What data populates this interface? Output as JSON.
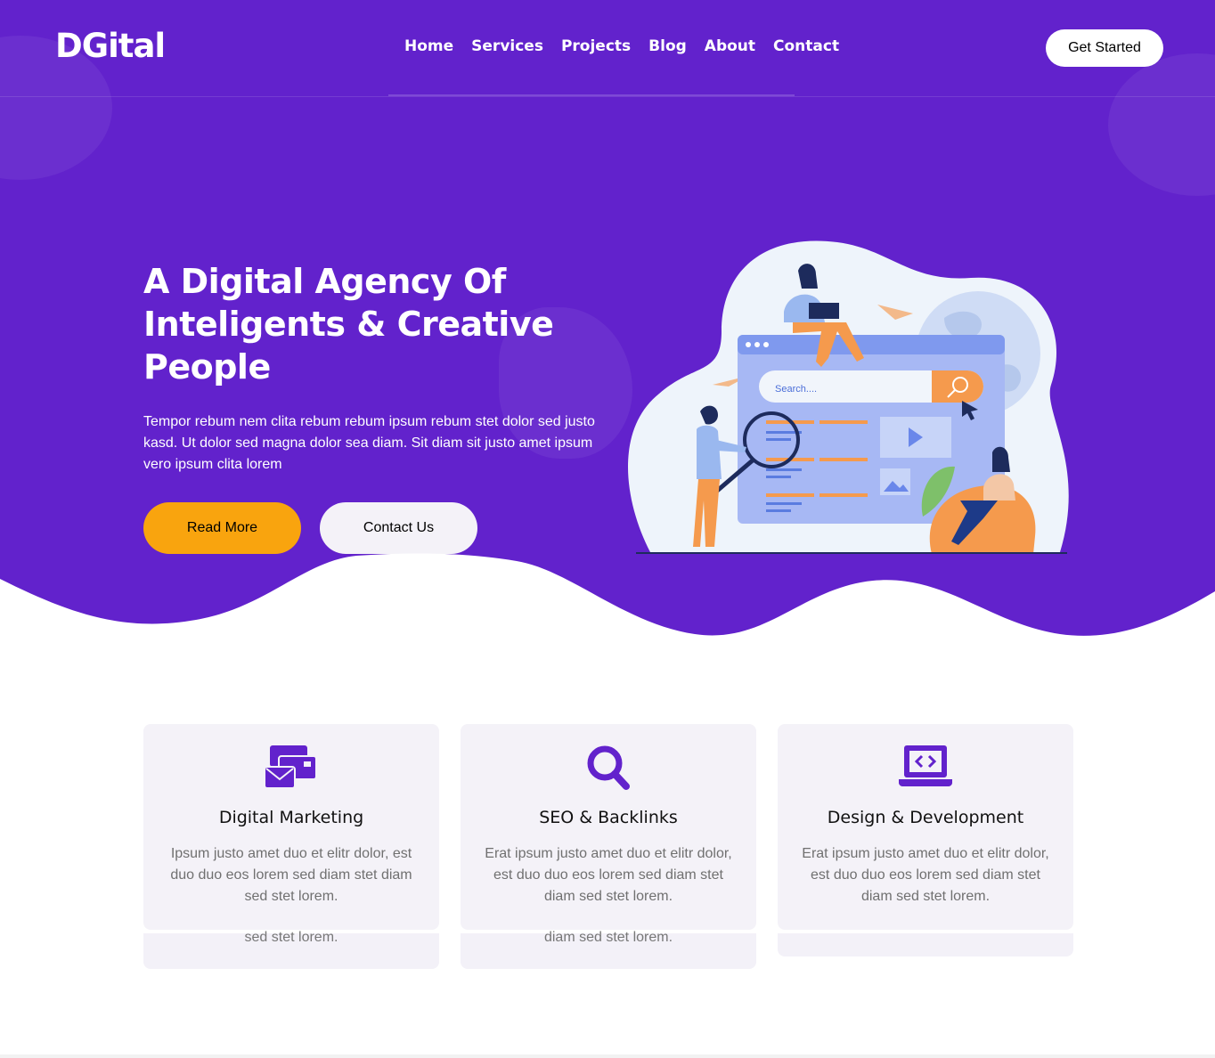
{
  "brand": {
    "logo": "DGital",
    "primary_color": "#6222cc",
    "accent_color": "#f9a40e"
  },
  "nav": {
    "links": [
      "Home",
      "Services",
      "Projects",
      "Blog",
      "About",
      "Contact"
    ],
    "cta": "Get Started"
  },
  "hero": {
    "title": "A Digital Agency Of Inteligents & Creative People",
    "text": "Tempor rebum nem clita rebum rebum ipsum rebum stet dolor sed justo kasd. Ut dolor sed magna dolor sea diam. Sit diam sit justo amet ipsum vero ipsum clita lorem",
    "read_more": "Read More",
    "contact_us": "Contact Us",
    "illustration": {
      "search_placeholder": "Search...."
    }
  },
  "services": [
    {
      "icon": "email-marketing-icon",
      "title": "Digital Marketing",
      "text": "Ipsum justo amet duo et elitr dolor, est duo duo eos lorem sed diam stet diam sed stet lorem.",
      "overflow_text": "sed stet lorem."
    },
    {
      "icon": "search-icon",
      "title": "SEO & Backlinks",
      "text": "Erat ipsum justo amet duo et elitr dolor, est duo duo eos lorem sed diam stet diam sed stet lorem.",
      "overflow_text": "diam sed stet lorem."
    },
    {
      "icon": "laptop-code-icon",
      "title": "Design & Development",
      "text": "Erat ipsum justo amet duo et elitr dolor, est duo duo eos lorem sed diam stet diam sed stet lorem.",
      "overflow_text": ""
    }
  ]
}
